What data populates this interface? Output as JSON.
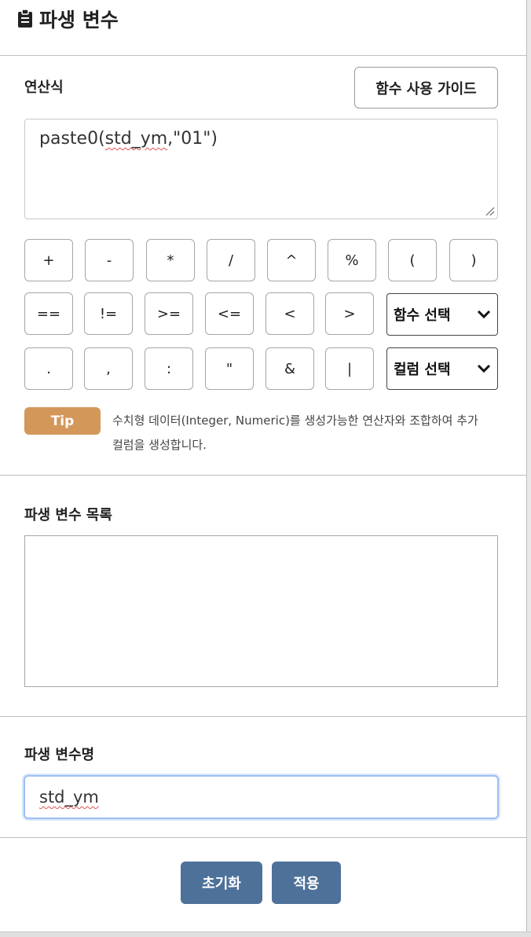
{
  "header": {
    "title": "파생 변수",
    "icon": "clipboard-icon"
  },
  "expression": {
    "label": "연산식",
    "guide_button": "함수 사용 가이드",
    "value_prefix": "paste0(",
    "value_underlined": "std_ym",
    "value_suffix": ",\"01\")"
  },
  "operators": {
    "row1": [
      "+",
      "-",
      "*",
      "/",
      "^",
      "%",
      "(",
      ")"
    ],
    "row2": [
      "==",
      "!=",
      ">=",
      "<=",
      "<",
      ">"
    ],
    "row3": [
      ".",
      ",",
      ":",
      "\"",
      "&",
      "|"
    ],
    "function_select": "함수 선택",
    "column_select": "컬럼 선택"
  },
  "tip": {
    "badge": "Tip",
    "line1": "수치형 데이터(Integer, Numeric)를 생성가능한 연산자와 조합하여 추가",
    "line2": "컬럼을 생성합니다."
  },
  "derived_list": {
    "label": "파생 변수 목록",
    "items": []
  },
  "variable_name": {
    "label": "파생 변수명",
    "value": "std_ym"
  },
  "actions": {
    "reset": "초기화",
    "apply": "적용"
  },
  "colors": {
    "accent": "#4d7199",
    "tip": "#d4975a",
    "focus": "#9cc0f3"
  }
}
